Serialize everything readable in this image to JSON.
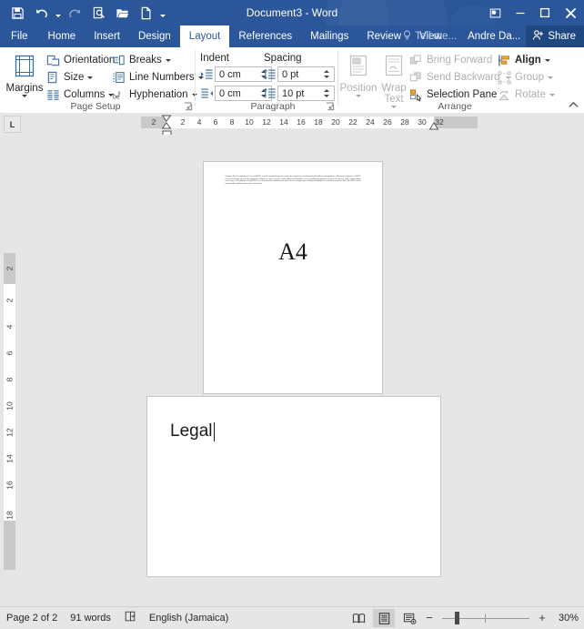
{
  "window": {
    "title": "Document3 - Word",
    "quick_access": [
      {
        "name": "save-icon",
        "label": "Save",
        "disabled": false
      },
      {
        "name": "undo-icon",
        "label": "Undo",
        "disabled": false,
        "has_caret": true
      },
      {
        "name": "redo-icon",
        "label": "Redo",
        "disabled": true
      },
      {
        "name": "print-preview-icon",
        "label": "Print Preview and Print",
        "disabled": false
      },
      {
        "name": "open-icon",
        "label": "Open",
        "disabled": false
      },
      {
        "name": "new-icon",
        "label": "New",
        "disabled": false
      }
    ],
    "qat_customize": "Customize Quick Access Toolbar",
    "controls": [
      {
        "name": "ribbon-display-options-icon",
        "label": "Ribbon Display Options"
      },
      {
        "name": "minimize-icon",
        "label": "Minimize"
      },
      {
        "name": "restore-icon",
        "label": "Restore Down"
      },
      {
        "name": "close-icon",
        "label": "Close"
      }
    ]
  },
  "tabs": {
    "items": [
      {
        "label": "File",
        "active": false,
        "file": true
      },
      {
        "label": "Home",
        "active": false
      },
      {
        "label": "Insert",
        "active": false
      },
      {
        "label": "Design",
        "active": false
      },
      {
        "label": "Layout",
        "active": true
      },
      {
        "label": "References",
        "active": false
      },
      {
        "label": "Mailings",
        "active": false
      },
      {
        "label": "Review",
        "active": false
      },
      {
        "label": "View",
        "active": false
      }
    ],
    "tell_me": "Tell me...",
    "tell_me_icon": "lightbulb-icon",
    "account": "Andre Da...",
    "share": "Share",
    "share_icon": "share-person-icon"
  },
  "ribbon": {
    "collapse_icon": "chevron-up-icon",
    "groups": [
      {
        "name": "page-setup",
        "label": "Page Setup",
        "has_dialog_launcher": true,
        "big_buttons": [
          {
            "label": "Margins",
            "icon": "margins-icon",
            "caret": true,
            "disabled": false
          }
        ],
        "items": [
          {
            "label": "Orientation",
            "icon": "orientation-icon",
            "caret": true,
            "disabled": false
          },
          {
            "label": "Size",
            "icon": "size-icon",
            "caret": true,
            "disabled": false
          },
          {
            "label": "Columns",
            "icon": "columns-icon",
            "caret": true,
            "disabled": false
          },
          {
            "label": "Breaks",
            "icon": "breaks-icon",
            "caret": true,
            "disabled": false
          },
          {
            "label": "Line Numbers",
            "icon": "line-numbers-icon",
            "caret": true,
            "disabled": false
          },
          {
            "label": "Hyphenation",
            "icon": "hyphenation-icon",
            "caret": true,
            "disabled": false
          }
        ]
      },
      {
        "name": "paragraph",
        "label": "Paragraph",
        "has_dialog_launcher": true,
        "column_labels": [
          "Indent",
          "Spacing"
        ],
        "fields": [
          {
            "name": "indent-left",
            "icon": "indent-left-icon",
            "value": "0 cm"
          },
          {
            "name": "indent-right",
            "icon": "indent-right-icon",
            "value": "0 cm"
          },
          {
            "name": "spacing-before",
            "icon": "spacing-before-icon",
            "value": "0 pt"
          },
          {
            "name": "spacing-after",
            "icon": "spacing-after-icon",
            "value": "10 pt"
          }
        ]
      },
      {
        "name": "arrange",
        "label": "Arrange",
        "has_dialog_launcher": false,
        "big_buttons": [
          {
            "label": "Position",
            "icon": "position-icon",
            "caret": true,
            "disabled": true
          },
          {
            "label": "Wrap Text",
            "icon": "wrap-text-icon",
            "caret": true,
            "disabled": true
          }
        ],
        "items": [
          {
            "label": "Bring Forward",
            "icon": "bring-forward-icon",
            "caret": true,
            "disabled": true
          },
          {
            "label": "Send Backward",
            "icon": "send-backward-icon",
            "caret": true,
            "disabled": true
          },
          {
            "label": "Selection Pane",
            "icon": "selection-pane-icon",
            "caret": false,
            "disabled": false
          },
          {
            "label": "Align",
            "icon": "align-icon",
            "caret": true,
            "disabled": false
          },
          {
            "label": "Group",
            "icon": "group-icon",
            "caret": true,
            "disabled": true
          },
          {
            "label": "Rotate",
            "icon": "rotate-icon",
            "caret": true,
            "disabled": true
          }
        ]
      }
    ]
  },
  "rulers": {
    "tab_stop_type": "L",
    "horizontal_numbers": [
      "2",
      "2",
      "4",
      "6",
      "8",
      "10",
      "12",
      "14",
      "16",
      "18",
      "20",
      "22",
      "24",
      "26",
      "28",
      "30",
      "32"
    ],
    "vertical_numbers": [
      "2",
      "2",
      "4",
      "6",
      "8",
      "10",
      "12",
      "14",
      "16",
      "18"
    ]
  },
  "document": {
    "pages": [
      {
        "name": "page-1",
        "size_label": "A4",
        "body_text": "Dynamic Host Configuration Protocol (DHCP), is an IP standard designed to reduce the complexity of administering IP address configurations. · Microsoft's definition. A DHCP server would come up with the appropriate settings for a given network. Such settings would include a set of fundamental parameters such as the gateway, DNS, subnet masks, and a range of IP addresses. Using DHCP on a network means administrators don't need to configure these settings individually for each client on the network. The DHCP would automatically distribute them to the clients itself."
      },
      {
        "name": "page-2",
        "size_label": "Legal",
        "body_text": "Legal"
      }
    ]
  },
  "status_bar": {
    "page_info": "Page 2 of 2",
    "word_count": "91 words",
    "proofing_icon": "proofing-errors-icon",
    "language": "English (Jamaica)",
    "views": [
      {
        "name": "read-mode-view-button",
        "label": "Read Mode",
        "selected": false
      },
      {
        "name": "print-layout-view-button",
        "label": "Print Layout",
        "selected": true
      },
      {
        "name": "web-layout-view-button",
        "label": "Web Layout",
        "selected": false
      }
    ],
    "zoom_out_label": "−",
    "zoom_in_label": "+",
    "zoom_level": "30%"
  },
  "colors": {
    "brand": "#2b579a",
    "ribbon_bg": "#ffffff",
    "canvas_bg": "#e6e6e6",
    "page_bg": "#ffffff",
    "share_bg": "#204880"
  }
}
